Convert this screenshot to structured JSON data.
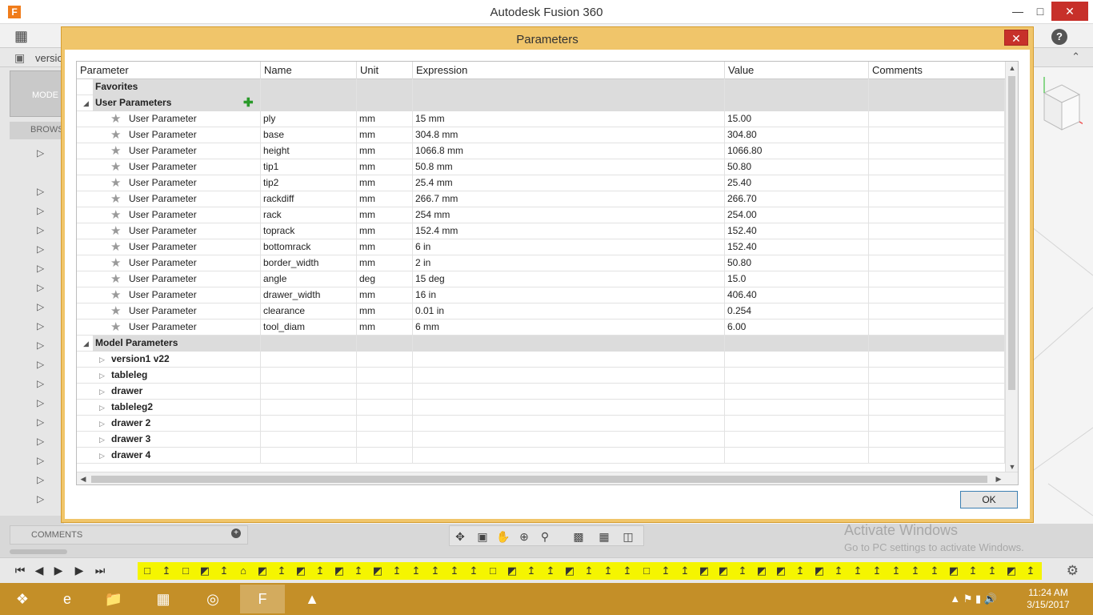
{
  "app": {
    "title": "Autodesk Fusion 360",
    "logo": "F",
    "doc_label": "versio",
    "mode_label": "MODE",
    "browser_label": "BROWS"
  },
  "dialog": {
    "title": "Parameters",
    "ok_label": "OK",
    "columns": [
      "Parameter",
      "Name",
      "Unit",
      "Expression",
      "Value",
      "Comments"
    ],
    "favorites_label": "Favorites",
    "user_params_label": "User Parameters",
    "model_params_label": "Model Parameters",
    "user_params": [
      {
        "param": "User Parameter",
        "name": "ply",
        "unit": "mm",
        "expr": "15 mm",
        "value": "15.00"
      },
      {
        "param": "User Parameter",
        "name": "base",
        "unit": "mm",
        "expr": "304.8 mm",
        "value": "304.80"
      },
      {
        "param": "User Parameter",
        "name": "height",
        "unit": "mm",
        "expr": "1066.8 mm",
        "value": "1066.80"
      },
      {
        "param": "User Parameter",
        "name": "tip1",
        "unit": "mm",
        "expr": "50.8 mm",
        "value": "50.80"
      },
      {
        "param": "User Parameter",
        "name": "tip2",
        "unit": "mm",
        "expr": "25.4 mm",
        "value": "25.40"
      },
      {
        "param": "User Parameter",
        "name": "rackdiff",
        "unit": "mm",
        "expr": "266.7 mm",
        "value": "266.70"
      },
      {
        "param": "User Parameter",
        "name": "rack",
        "unit": "mm",
        "expr": "254 mm",
        "value": "254.00"
      },
      {
        "param": "User Parameter",
        "name": "toprack",
        "unit": "mm",
        "expr": "152.4 mm",
        "value": "152.40"
      },
      {
        "param": "User Parameter",
        "name": "bottomrack",
        "unit": "mm",
        "expr": "6 in",
        "value": "152.40"
      },
      {
        "param": "User Parameter",
        "name": "border_width",
        "unit": "mm",
        "expr": "2 in",
        "value": "50.80"
      },
      {
        "param": "User Parameter",
        "name": "angle",
        "unit": "deg",
        "expr": "15 deg",
        "value": "15.0"
      },
      {
        "param": "User Parameter",
        "name": "drawer_width",
        "unit": "mm",
        "expr": "16 in",
        "value": "406.40"
      },
      {
        "param": "User Parameter",
        "name": "clearance",
        "unit": "mm",
        "expr": "0.01 in",
        "value": "0.254"
      },
      {
        "param": "User Parameter",
        "name": "tool_diam",
        "unit": "mm",
        "expr": "6 mm",
        "value": "6.00"
      }
    ],
    "model_params": [
      "version1 v22",
      "tableleg",
      "drawer",
      "tableleg2",
      "drawer 2",
      "drawer 3",
      "drawer 4"
    ]
  },
  "comments_label": "COMMENTS",
  "activate": {
    "line1": "Activate Windows",
    "line2": "Go to PC settings to activate Windows."
  },
  "clock": {
    "time": "11:24 AM",
    "date": "3/15/2017"
  },
  "colors": {
    "dialog_frame": "#f0c56a",
    "taskbar": "#c48f28",
    "timeline_strip": "#f5f500"
  }
}
